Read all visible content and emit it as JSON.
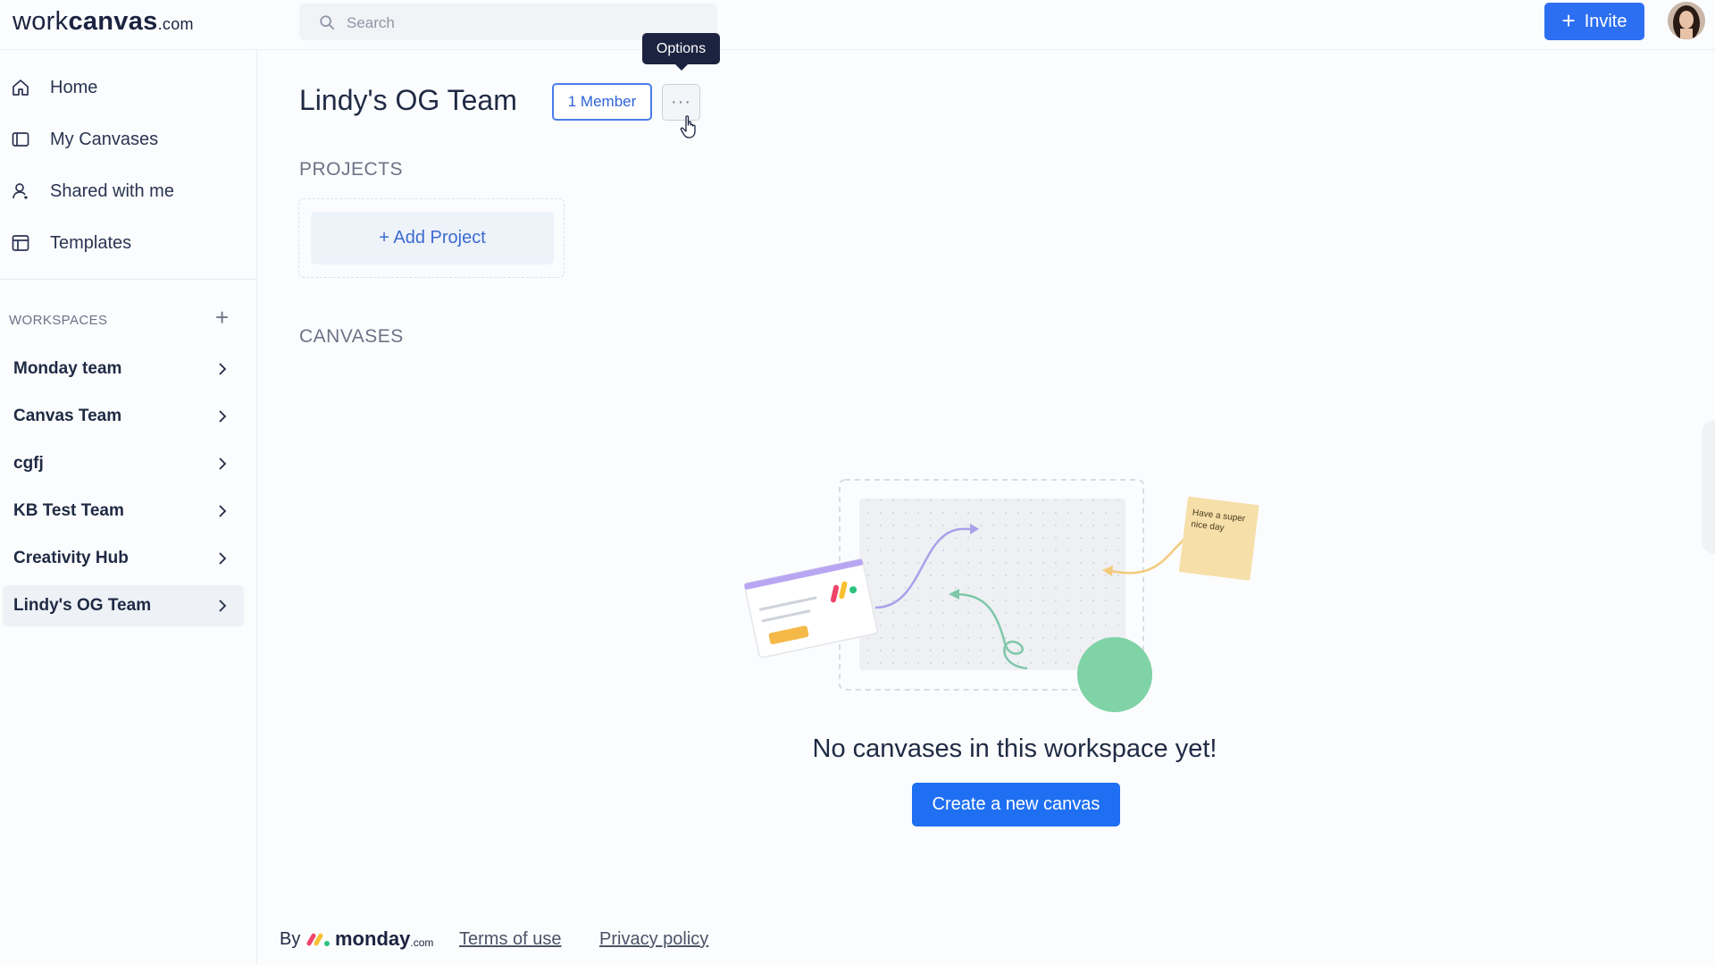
{
  "brand": {
    "logo_light": "work",
    "logo_bold": "canvas",
    "logo_suffix": ".com"
  },
  "search": {
    "placeholder": "Search"
  },
  "header": {
    "invite_label": "Invite"
  },
  "sidebar": {
    "nav": [
      {
        "label": "Home",
        "icon": "home-icon"
      },
      {
        "label": "My Canvases",
        "icon": "canvas-icon"
      },
      {
        "label": "Shared with me",
        "icon": "person-icon"
      },
      {
        "label": "Templates",
        "icon": "template-icon"
      }
    ],
    "workspaces_heading": "WORKSPACES",
    "workspaces": [
      {
        "label": "Monday team"
      },
      {
        "label": "Canvas Team"
      },
      {
        "label": "cgfj"
      },
      {
        "label": "KB Test Team"
      },
      {
        "label": "Creativity Hub"
      },
      {
        "label": "Lindy's OG Team",
        "active": true
      }
    ]
  },
  "main": {
    "title": "Lindy's OG Team",
    "member_label": "1 Member",
    "options_tooltip": "Options",
    "options_glyph": "···",
    "projects_heading": "PROJECTS",
    "add_project_label": "+ Add Project",
    "canvases_heading": "CANVASES",
    "empty_message": "No canvases in this workspace yet!",
    "create_label": "Create a new canvas",
    "sticky_note": "Have a super nice day"
  },
  "footer": {
    "by": "By",
    "brand": "monday",
    "brand_suffix": ".com",
    "terms": "Terms of use",
    "privacy": "Privacy policy"
  },
  "colors": {
    "accent": "#2d6ff2",
    "text": "#1f2a44",
    "muted": "#6b7386",
    "sticky": "#f6dfa8",
    "circle": "#7fd3a6"
  }
}
